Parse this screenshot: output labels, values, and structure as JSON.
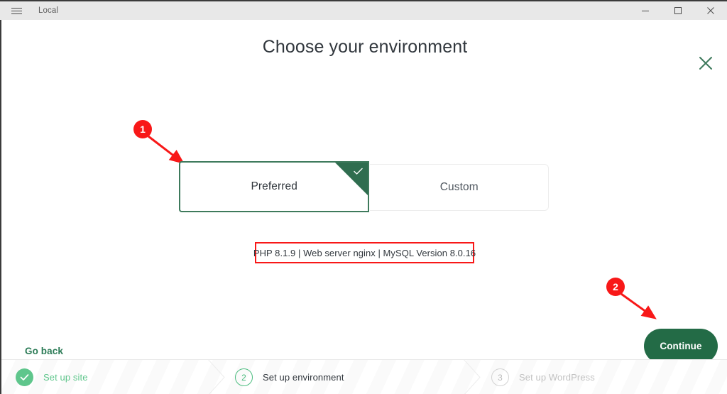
{
  "titlebar": {
    "menu_icon": "hamburger-icon",
    "app_name": "Local",
    "minimize": "—",
    "maximize": "▢",
    "close": "✕"
  },
  "header": {
    "title": "Choose your environment",
    "close_icon": "close-icon",
    "close_color": "#3e7a5c"
  },
  "environment": {
    "tabs": [
      {
        "label": "Preferred",
        "selected": true,
        "check_icon": "check-icon"
      },
      {
        "label": "Custom",
        "selected": false
      }
    ],
    "details": "PHP 8.1.9 | Web server nginx | MySQL Version 8.0.16",
    "selected_border_color": "#3e7a5c",
    "selected_corner_color": "#2f6d4f"
  },
  "actions": {
    "go_back": "Go back",
    "continue": "Continue",
    "continue_color": "#236b46",
    "go_back_color": "#2a7a55"
  },
  "stepper": {
    "steps": [
      {
        "number": "1",
        "label": "Set up site",
        "state": "done",
        "icon": "check-icon",
        "color": "#5fc68c"
      },
      {
        "number": "2",
        "label": "Set up environment",
        "state": "current",
        "color": "#4cbd80"
      },
      {
        "number": "3",
        "label": "Set up WordPress",
        "state": "todo",
        "color": "#c2c2c2"
      }
    ]
  },
  "annotations": {
    "color": "#f81818",
    "markers": [
      {
        "number": "1",
        "target": "preferred-environment-tab"
      },
      {
        "number": "2",
        "target": "continue-button"
      }
    ],
    "highlight_box": "environment-details-text"
  }
}
